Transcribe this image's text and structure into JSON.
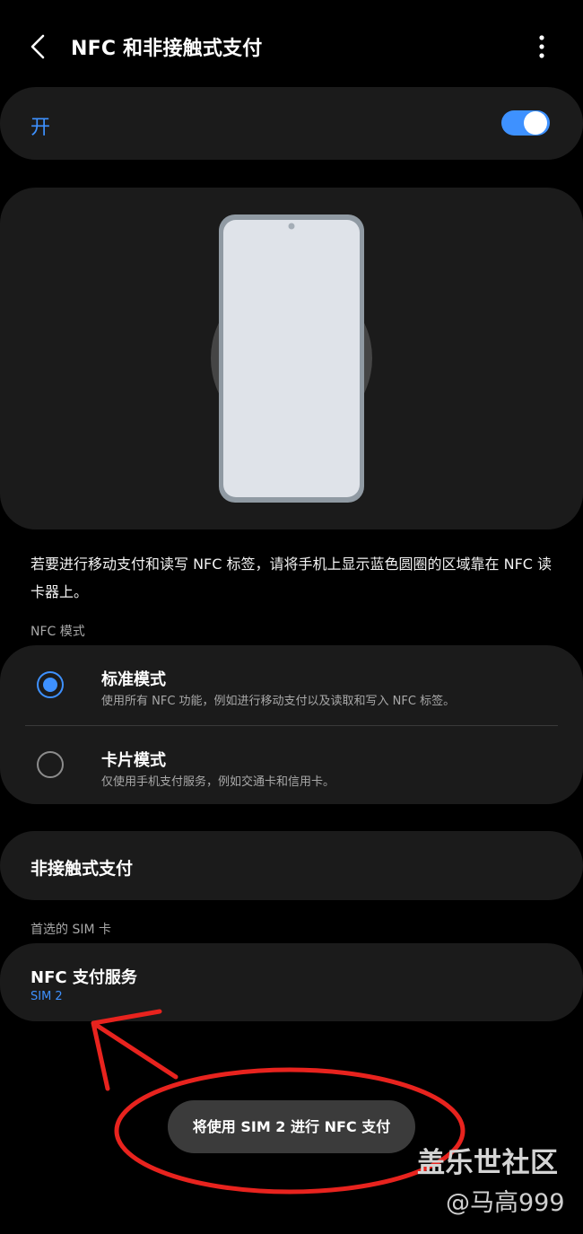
{
  "header": {
    "title": "NFC 和非接触式支付",
    "back_icon": "chevron-left-icon",
    "more_icon": "more-vertical-icon"
  },
  "master_switch": {
    "label": "开",
    "on": true
  },
  "description": "若要进行移动支付和读写 NFC 标签，请将手机上显示蓝色圆圈的区域靠在 NFC 读卡器上。",
  "nfc_mode": {
    "section_label": "NFC 模式",
    "options": [
      {
        "title": "标准模式",
        "subtitle": "使用所有 NFC 功能，例如进行移动支付以及读取和写入 NFC 标签。",
        "selected": true
      },
      {
        "title": "卡片模式",
        "subtitle": "仅使用手机支付服务，例如交通卡和信用卡。",
        "selected": false
      }
    ]
  },
  "contactless_payment": {
    "label": "非接触式支付"
  },
  "preferred_sim": {
    "section_label": "首选的 SIM 卡",
    "title": "NFC 支付服务",
    "value": "SIM 2"
  },
  "toast": {
    "text": "将使用 SIM 2 进行 NFC 支付"
  },
  "watermark": {
    "site": "盖乐世社区",
    "user": "@马高999"
  },
  "colors": {
    "accent": "#3e91ff",
    "background": "#000000",
    "card": "#1b1b1b",
    "annotation": "#e8231e"
  }
}
